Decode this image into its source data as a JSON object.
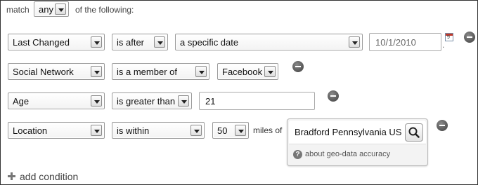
{
  "header": {
    "match_label": "match",
    "match_value": "any",
    "of_following": "of the following:"
  },
  "conditions": [
    {
      "field": "Last Changed",
      "operator": "is after",
      "value_select": "a specific date",
      "date_value": "10/1/2010",
      "calendar_day": "9"
    },
    {
      "field": "Social Network",
      "operator": "is a member of",
      "value_select": "Facebook"
    },
    {
      "field": "Age",
      "operator": "is greater than",
      "text_value": "21"
    },
    {
      "field": "Location",
      "operator": "is within",
      "distance": "50",
      "miles_of": "miles of",
      "location_value": "Bradford Pennsylvania US",
      "geo_help": "?",
      "geo_link": "about geo-data accuracy"
    }
  ],
  "footer": {
    "add_condition": "add condition"
  },
  "icons": {
    "remove": "minus-circle-icon",
    "add": "plus-icon",
    "search": "magnifier-icon",
    "calendar": "calendar-icon",
    "help": "question-icon"
  }
}
